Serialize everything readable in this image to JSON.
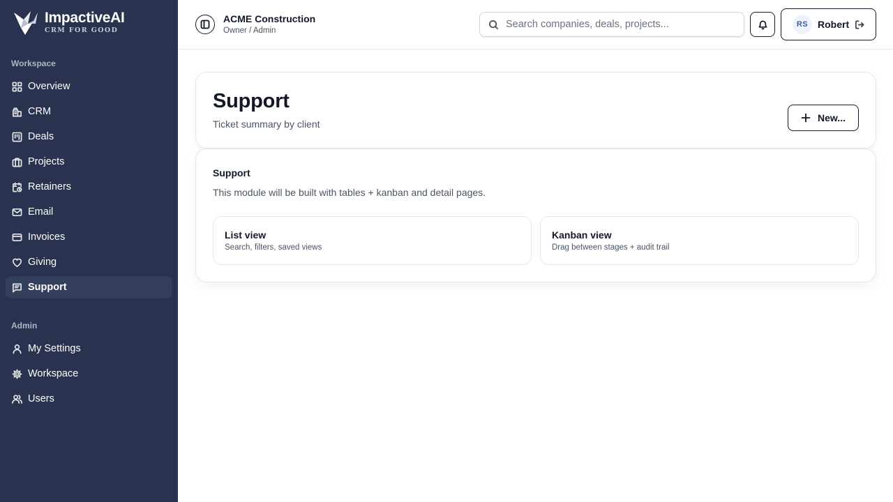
{
  "brand": {
    "name": "ImpactiveAI",
    "tagline": "CRM FOR GOOD"
  },
  "sidebar": {
    "workspace_label": "Workspace",
    "admin_label": "Admin",
    "items": [
      {
        "label": "Overview",
        "icon": "grid-icon"
      },
      {
        "label": "CRM",
        "icon": "building-icon"
      },
      {
        "label": "Deals",
        "icon": "kanban-icon"
      },
      {
        "label": "Projects",
        "icon": "briefcase-icon"
      },
      {
        "label": "Retainers",
        "icon": "calendar-clock-icon"
      },
      {
        "label": "Email",
        "icon": "mail-icon"
      },
      {
        "label": "Invoices",
        "icon": "credit-card-icon"
      },
      {
        "label": "Giving",
        "icon": "heart-icon"
      },
      {
        "label": "Support",
        "icon": "message-icon",
        "active": true
      }
    ],
    "admin_items": [
      {
        "label": "My Settings",
        "icon": "user-icon"
      },
      {
        "label": "Workspace",
        "icon": "gear-icon"
      },
      {
        "label": "Users",
        "icon": "users-icon"
      }
    ]
  },
  "topbar": {
    "org_name": "ACME Construction",
    "org_role": "Owner / Admin",
    "search_placeholder": "Search companies, deals, projects...",
    "user_initials": "RS",
    "user_name": "Robert"
  },
  "page": {
    "title": "Support",
    "subtitle": "Ticket summary by client",
    "new_button": "New..."
  },
  "module": {
    "title": "Support",
    "description": "This module will be built with tables + kanban and detail pages.",
    "views": [
      {
        "title": "List view",
        "subtitle": "Search, filters, saved views"
      },
      {
        "title": "Kanban view",
        "subtitle": "Drag between stages + audit trail"
      }
    ]
  },
  "colors": {
    "sidebar_bg": "#29334f",
    "sidebar_active": "#343f5c",
    "accent_avatar": "#3b5ba9"
  }
}
